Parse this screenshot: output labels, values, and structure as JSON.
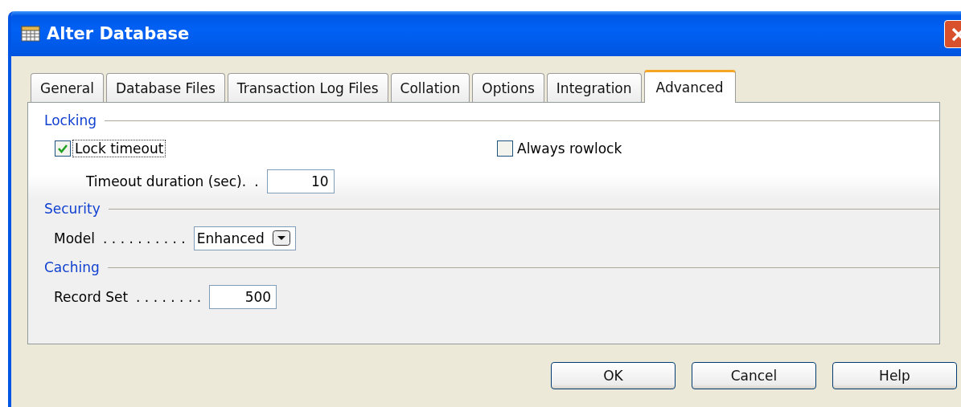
{
  "window": {
    "title": "Alter Database"
  },
  "tabs": [
    {
      "label": "General",
      "selected": false
    },
    {
      "label": "Database Files",
      "selected": false
    },
    {
      "label": "Transaction Log Files",
      "selected": false
    },
    {
      "label": "Collation",
      "selected": false
    },
    {
      "label": "Options",
      "selected": false
    },
    {
      "label": "Integration",
      "selected": false
    },
    {
      "label": "Advanced",
      "selected": true
    }
  ],
  "sections": [
    {
      "title": "Locking",
      "rows": [
        {
          "kind": "checks",
          "items": [
            {
              "label": "Lock timeout",
              "checked": true,
              "focused": true
            },
            {
              "label": "Always rowlock",
              "checked": false,
              "focused": false
            }
          ]
        },
        {
          "kind": "subtext",
          "label": "Timeout duration (sec).",
          "leader": ".",
          "value": "10"
        }
      ]
    },
    {
      "title": "Security",
      "rows": [
        {
          "kind": "select",
          "label": "Model",
          "leader": ". . . . . . . . . .",
          "value": "Enhanced"
        }
      ]
    },
    {
      "title": "Caching",
      "rows": [
        {
          "kind": "text",
          "label": "Record Set",
          "leader": ". . . . . . . .",
          "value": "500"
        }
      ]
    }
  ],
  "buttons": [
    "OK",
    "Cancel",
    "Help"
  ]
}
